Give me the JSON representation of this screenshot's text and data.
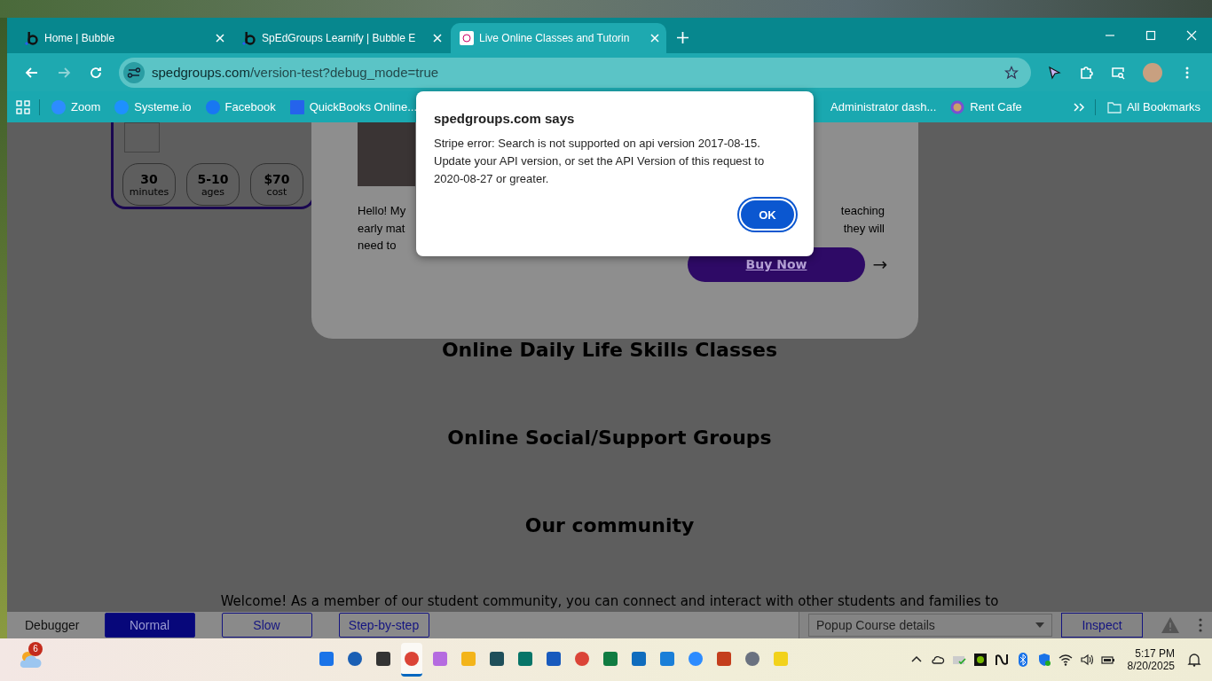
{
  "tabs": [
    {
      "title": "Home | Bubble",
      "selected": false
    },
    {
      "title": "SpEdGroups Learnify | Bubble E",
      "selected": false
    },
    {
      "title": "Live Online Classes and Tutorin",
      "selected": true
    }
  ],
  "address": {
    "host": "spedgroups.com",
    "path": "/version-test?debug_mode=true"
  },
  "bookmarks": [
    {
      "label": "Zoom"
    },
    {
      "label": "Systeme.io"
    },
    {
      "label": "Facebook"
    },
    {
      "label": "QuickBooks Online..."
    },
    {
      "label": "Administrator dash..."
    },
    {
      "label": "Rent Cafe"
    }
  ],
  "all_bookmarks": "All Bookmarks",
  "dialog": {
    "title": "spedgroups.com says",
    "message": "Stripe error: Search is not supported on api version 2017-08-15. Update your API version, or set the API Version of this request to 2020-08-27 or greater.",
    "button": "OK"
  },
  "course_card": {
    "stats": [
      {
        "value": "30",
        "label": "minutes"
      },
      {
        "value": "5-10",
        "label": "ages"
      },
      {
        "value": "$70",
        "label": "cost"
      }
    ]
  },
  "popup": {
    "bio_left": [
      "Hello! My",
      "early mat",
      "need to"
    ],
    "bio_right": [
      "teaching",
      "they will"
    ],
    "button": "Buy Now",
    "arrow": "→"
  },
  "headings": [
    "Online Daily Life Skills Classes",
    "Online Social/Support Groups",
    "Our community"
  ],
  "welcome": "Welcome! As a member of our student community, you can connect and interact with other students and families to",
  "debugger": {
    "label": "Debugger",
    "modes": [
      {
        "label": "Normal",
        "selected": true
      },
      {
        "label": "Slow",
        "selected": false
      },
      {
        "label": "Step-by-step",
        "selected": false
      }
    ],
    "element": "Popup Course details",
    "inspect": "Inspect"
  },
  "taskbar": {
    "weather_badge": "6",
    "apps": [
      {
        "kind": "start",
        "active": false
      },
      {
        "kind": "search",
        "active": false
      },
      {
        "kind": "taskview",
        "active": false
      },
      {
        "kind": "chrome",
        "active": true
      },
      {
        "kind": "copilot",
        "active": false
      },
      {
        "kind": "files",
        "active": false
      },
      {
        "kind": "teal",
        "active": false
      },
      {
        "kind": "publisher",
        "active": false
      },
      {
        "kind": "word",
        "active": false
      },
      {
        "kind": "chrome",
        "active": false
      },
      {
        "kind": "excel",
        "active": false
      },
      {
        "kind": "outlook",
        "active": false
      },
      {
        "kind": "mail",
        "active": false
      },
      {
        "kind": "zoom",
        "active": false
      },
      {
        "kind": "powerpoint",
        "active": false
      },
      {
        "kind": "settings",
        "active": false
      },
      {
        "kind": "yellow",
        "active": false
      }
    ],
    "time": "5:17 PM",
    "date": "8/20/2025"
  }
}
